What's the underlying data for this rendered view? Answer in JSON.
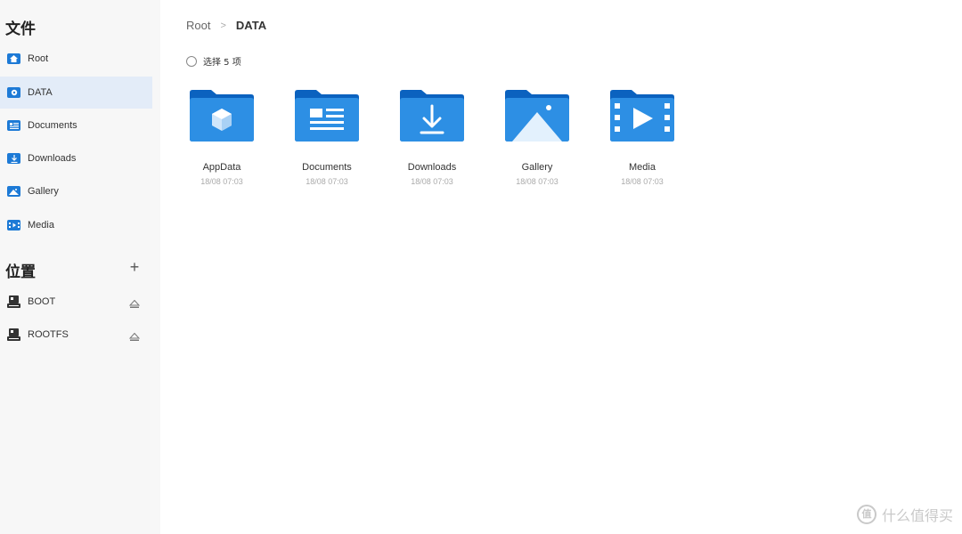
{
  "sidebar": {
    "files_title": "文件",
    "items": [
      {
        "label": "Root",
        "icon": "home-icon"
      },
      {
        "label": "DATA",
        "icon": "data-icon"
      },
      {
        "label": "Documents",
        "icon": "documents-icon"
      },
      {
        "label": "Downloads",
        "icon": "downloads-icon"
      },
      {
        "label": "Gallery",
        "icon": "gallery-icon"
      },
      {
        "label": "Media",
        "icon": "media-icon"
      }
    ],
    "locations_title": "位置",
    "add_label": "+",
    "drives": [
      {
        "label": "BOOT",
        "icon": "drive-icon"
      },
      {
        "label": "ROOTFS",
        "icon": "drive-icon"
      }
    ]
  },
  "breadcrumb": {
    "root": "Root",
    "separator": ">",
    "current": "DATA"
  },
  "selection": {
    "label": "选择 5 项"
  },
  "folders": [
    {
      "name": "AppData",
      "date": "18/08 07:03",
      "icon": "appdata-folder-icon"
    },
    {
      "name": "Documents",
      "date": "18/08 07:03",
      "icon": "documents-folder-icon"
    },
    {
      "name": "Downloads",
      "date": "18/08 07:03",
      "icon": "downloads-folder-icon"
    },
    {
      "name": "Gallery",
      "date": "18/08 07:03",
      "icon": "gallery-folder-icon"
    },
    {
      "name": "Media",
      "date": "18/08 07:03",
      "icon": "media-folder-icon"
    }
  ],
  "watermark": {
    "logo": "值",
    "text": "什么值得买"
  },
  "colors": {
    "accent": "#1d7ad6",
    "folder_dark": "#0b62bf",
    "folder_light": "#2d8fe4",
    "active_bg": "#e3ecf8",
    "sidebar_bg": "#f7f7f7"
  }
}
